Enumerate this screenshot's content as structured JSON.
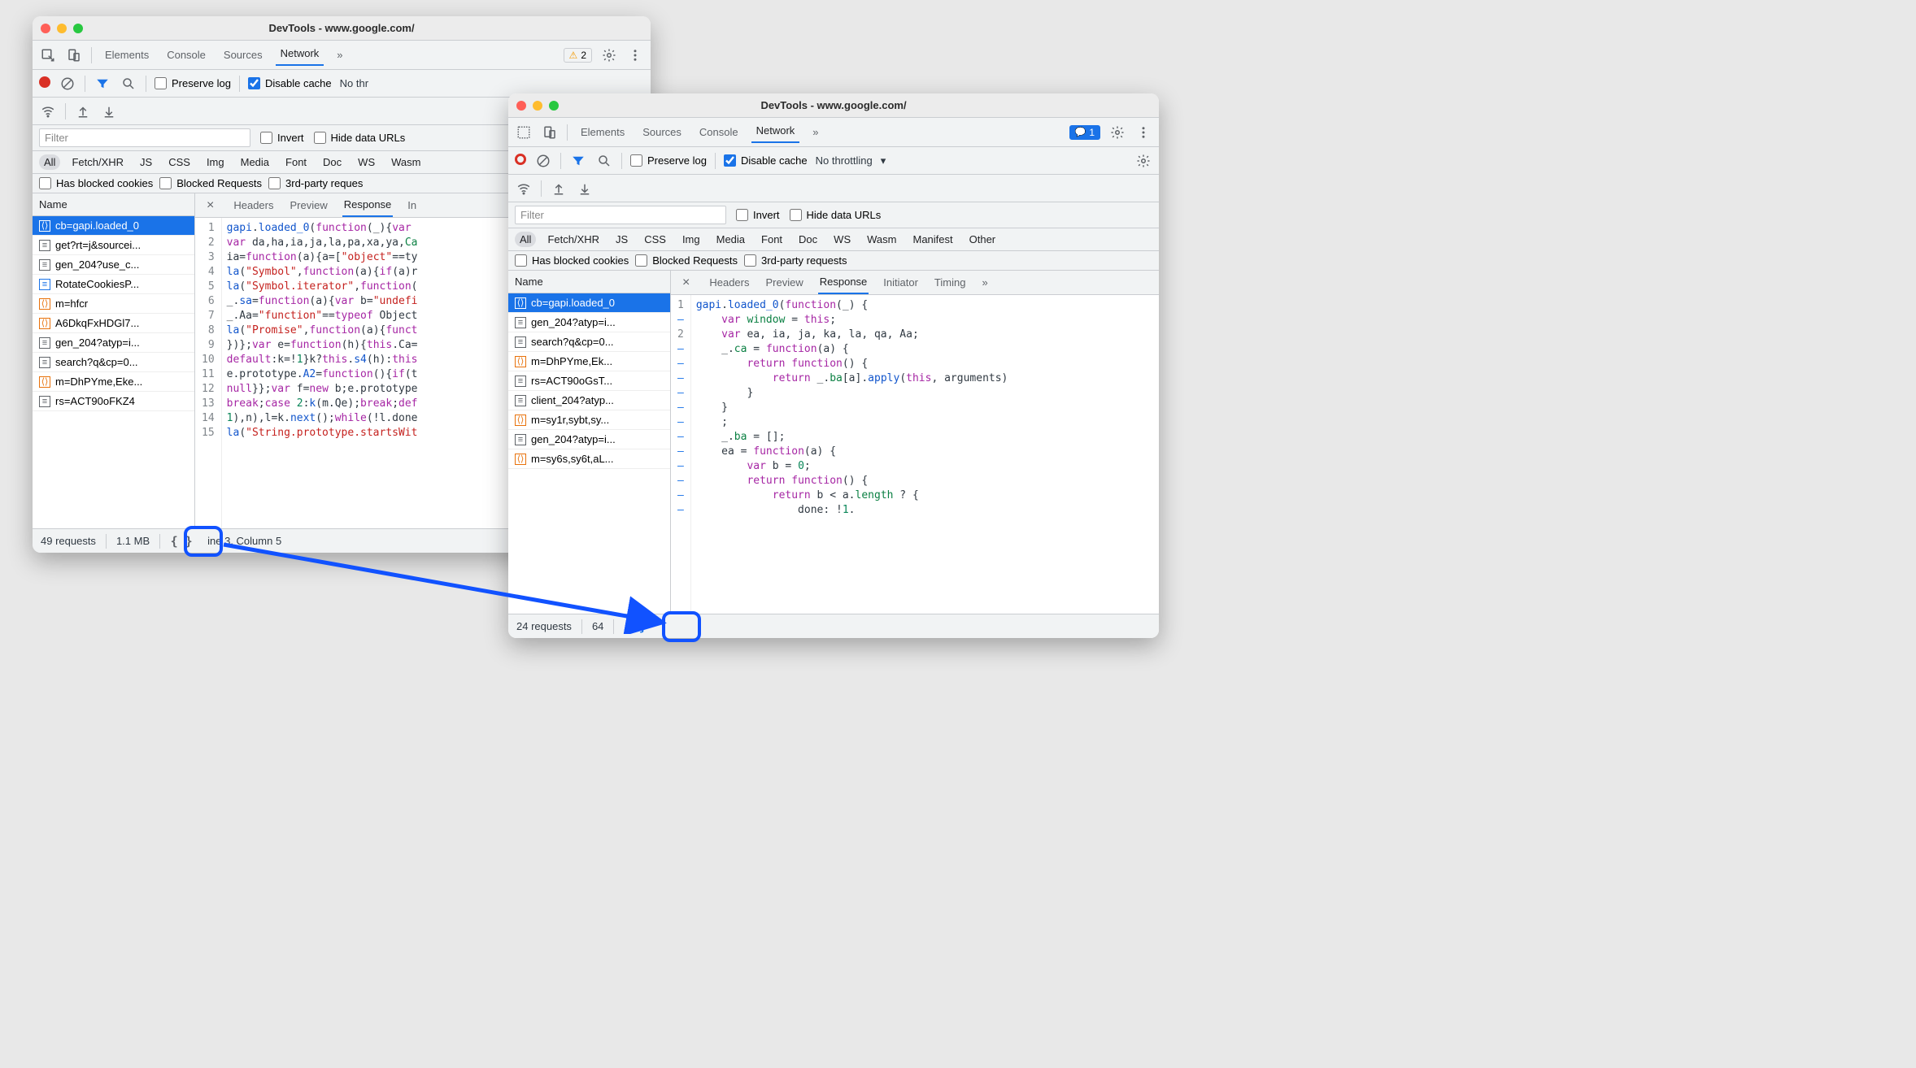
{
  "window1": {
    "title": "DevTools - www.google.com/",
    "topTabs": [
      "Elements",
      "Console",
      "Sources",
      "Network"
    ],
    "topActive": 3,
    "more": "»",
    "warnCount": "2",
    "preserveLabel": "Preserve log",
    "disableCacheLabel": "Disable cache",
    "disableCacheChecked": true,
    "throttling": "No thr",
    "filterPlaceholder": "Filter",
    "invertLabel": "Invert",
    "hideDataLabel": "Hide data URLs",
    "typeChips": [
      "All",
      "Fetch/XHR",
      "JS",
      "CSS",
      "Img",
      "Media",
      "Font",
      "Doc",
      "WS",
      "Wasm"
    ],
    "typeActive": 0,
    "extraChecks": [
      "Has blocked cookies",
      "Blocked Requests",
      "3rd-party reques"
    ],
    "nameHeader": "Name",
    "files": [
      {
        "icon": "orange",
        "name": "cb=gapi.loaded_0",
        "sel": true
      },
      {
        "icon": "doc",
        "name": "get?rt=j&sourcei..."
      },
      {
        "icon": "doc",
        "name": "gen_204?use_c..."
      },
      {
        "icon": "blue",
        "name": "RotateCookiesP..."
      },
      {
        "icon": "orange",
        "name": "m=hfcr"
      },
      {
        "icon": "orange",
        "name": "A6DkqFxHDGl7..."
      },
      {
        "icon": "doc",
        "name": "gen_204?atyp=i..."
      },
      {
        "icon": "doc",
        "name": "search?q&cp=0..."
      },
      {
        "icon": "orange",
        "name": "m=DhPYme,Eke..."
      },
      {
        "icon": "doc",
        "name": "rs=ACT90oFKZ4"
      }
    ],
    "detailTabs": [
      "Headers",
      "Preview",
      "Response",
      "In"
    ],
    "detailActive": 2,
    "codeLines": [
      [
        [
          "fn",
          "gapi"
        ],
        [
          "plain",
          "."
        ],
        [
          "fn",
          "loaded_0"
        ],
        [
          "plain",
          "("
        ],
        [
          "kw",
          "function"
        ],
        [
          "plain",
          "(_){"
        ],
        [
          "kw",
          "var"
        ]
      ],
      [
        [
          "kw",
          "var"
        ],
        [
          "plain",
          " da,ha,ia,ja,la,pa,xa,ya,"
        ],
        [
          "id",
          "Ca"
        ]
      ],
      [
        [
          "plain",
          "ia="
        ],
        [
          "kw",
          "function"
        ],
        [
          "plain",
          "(a){a=["
        ],
        [
          "str",
          "\"object\""
        ],
        [
          "plain",
          "==ty"
        ]
      ],
      [
        [
          "fn",
          "la"
        ],
        [
          "plain",
          "("
        ],
        [
          "str",
          "\"Symbol\""
        ],
        [
          "plain",
          ","
        ],
        [
          "kw",
          "function"
        ],
        [
          "plain",
          "(a){"
        ],
        [
          "kw",
          "if"
        ],
        [
          "plain",
          "(a)r"
        ]
      ],
      [
        [
          "fn",
          "la"
        ],
        [
          "plain",
          "("
        ],
        [
          "str",
          "\"Symbol.iterator\""
        ],
        [
          "plain",
          ","
        ],
        [
          "kw",
          "function"
        ],
        [
          "plain",
          "("
        ]
      ],
      [
        [
          "plain",
          "_."
        ],
        [
          "fn",
          "sa"
        ],
        [
          "plain",
          "="
        ],
        [
          "kw",
          "function"
        ],
        [
          "plain",
          "(a){"
        ],
        [
          "kw",
          "var"
        ],
        [
          "plain",
          " b="
        ],
        [
          "str",
          "\"undefi"
        ]
      ],
      [
        [
          "plain",
          "_.Aa="
        ],
        [
          "str",
          "\"function\""
        ],
        [
          "plain",
          "=="
        ],
        [
          "kw",
          "typeof"
        ],
        [
          "plain",
          " Object"
        ]
      ],
      [
        [
          "fn",
          "la"
        ],
        [
          "plain",
          "("
        ],
        [
          "str",
          "\"Promise\""
        ],
        [
          "plain",
          ","
        ],
        [
          "kw",
          "function"
        ],
        [
          "plain",
          "(a){"
        ],
        [
          "kw",
          "funct"
        ]
      ],
      [
        [
          "plain",
          "})};"
        ],
        [
          "kw",
          "var"
        ],
        [
          "plain",
          " e="
        ],
        [
          "kw",
          "function"
        ],
        [
          "plain",
          "(h){"
        ],
        [
          "kw",
          "this"
        ],
        [
          "plain",
          ".Ca="
        ]
      ],
      [
        [
          "kw",
          "default"
        ],
        [
          "plain",
          ":k=!"
        ],
        [
          "num",
          "1"
        ],
        [
          "plain",
          "}k?"
        ],
        [
          "kw",
          "this"
        ],
        [
          "plain",
          "."
        ],
        [
          "fn",
          "s4"
        ],
        [
          "plain",
          "(h):"
        ],
        [
          "kw",
          "this"
        ]
      ],
      [
        [
          "plain",
          "e.prototype."
        ],
        [
          "fn",
          "A2"
        ],
        [
          "plain",
          "="
        ],
        [
          "kw",
          "function"
        ],
        [
          "plain",
          "(){"
        ],
        [
          "kw",
          "if"
        ],
        [
          "plain",
          "(t"
        ]
      ],
      [
        [
          "kw",
          "null"
        ],
        [
          "plain",
          "}};"
        ],
        [
          "kw",
          "var"
        ],
        [
          "plain",
          " f="
        ],
        [
          "kw",
          "new"
        ],
        [
          "plain",
          " b;e.prototype"
        ]
      ],
      [
        [
          "kw",
          "break"
        ],
        [
          "plain",
          ";"
        ],
        [
          "kw",
          "case"
        ],
        [
          "plain",
          " "
        ],
        [
          "num",
          "2"
        ],
        [
          "plain",
          ":"
        ],
        [
          "fn",
          "k"
        ],
        [
          "plain",
          "(m.Qe);"
        ],
        [
          "kw",
          "break"
        ],
        [
          "plain",
          ";"
        ],
        [
          "kw",
          "def"
        ]
      ],
      [
        [
          "num",
          "1"
        ],
        [
          "plain",
          "),n),l=k."
        ],
        [
          "fn",
          "next"
        ],
        [
          "plain",
          "();"
        ],
        [
          "kw",
          "while"
        ],
        [
          "plain",
          "(!l.done"
        ]
      ],
      [
        [
          "fn",
          "la"
        ],
        [
          "plain",
          "("
        ],
        [
          "str",
          "\"String.prototype.startsWit"
        ]
      ]
    ],
    "status": {
      "requests": "49 requests",
      "size": "1.1 MB",
      "cursor": "ine 3, Column 5"
    }
  },
  "window2": {
    "title": "DevTools - www.google.com/",
    "topTabs": [
      "Elements",
      "Sources",
      "Console",
      "Network"
    ],
    "topActive": 3,
    "more": "»",
    "blueCount": "1",
    "preserveLabel": "Preserve log",
    "disableCacheLabel": "Disable cache",
    "disableCacheChecked": true,
    "throttling": "No throttling",
    "filterPlaceholder": "Filter",
    "invertLabel": "Invert",
    "hideDataLabel": "Hide data URLs",
    "typeChips": [
      "All",
      "Fetch/XHR",
      "JS",
      "CSS",
      "Img",
      "Media",
      "Font",
      "Doc",
      "WS",
      "Wasm",
      "Manifest",
      "Other"
    ],
    "typeActive": 0,
    "extraChecks": [
      "Has blocked cookies",
      "Blocked Requests",
      "3rd-party requests"
    ],
    "nameHeader": "Name",
    "files": [
      {
        "icon": "orange",
        "name": "cb=gapi.loaded_0",
        "sel": true
      },
      {
        "icon": "doc",
        "name": "gen_204?atyp=i..."
      },
      {
        "icon": "doc",
        "name": "search?q&cp=0..."
      },
      {
        "icon": "orange",
        "name": "m=DhPYme,Ek..."
      },
      {
        "icon": "doc",
        "name": "rs=ACT90oGsT..."
      },
      {
        "icon": "doc",
        "name": "client_204?atyp..."
      },
      {
        "icon": "orange",
        "name": "m=sy1r,sybt,sy..."
      },
      {
        "icon": "doc",
        "name": "gen_204?atyp=i..."
      },
      {
        "icon": "orange",
        "name": "m=sy6s,sy6t,aL..."
      }
    ],
    "detailTabs": [
      "Headers",
      "Preview",
      "Response",
      "Initiator",
      "Timing",
      "»"
    ],
    "detailActive": 2,
    "gutter": [
      "1",
      "–",
      "2",
      "–",
      "–",
      "–",
      "–",
      "–",
      "–",
      "–",
      "–",
      "–",
      "–",
      "–",
      "–",
      "–"
    ],
    "codeLines": [
      [
        [
          "fn",
          "gapi"
        ],
        [
          "plain",
          "."
        ],
        [
          "fn",
          "loaded_0"
        ],
        [
          "plain",
          "("
        ],
        [
          "kw",
          "function"
        ],
        [
          "plain",
          "(_) {"
        ]
      ],
      [
        [
          "plain",
          "    "
        ],
        [
          "kw",
          "var"
        ],
        [
          "plain",
          " "
        ],
        [
          "id",
          "window"
        ],
        [
          "plain",
          " = "
        ],
        [
          "kw",
          "this"
        ],
        [
          "plain",
          ";"
        ]
      ],
      [
        [
          "plain",
          "    "
        ],
        [
          "kw",
          "var"
        ],
        [
          "plain",
          " ea, ia, ja, ka, la, qa, Aa;"
        ]
      ],
      [
        [
          "plain",
          "    _."
        ],
        [
          "id",
          "ca"
        ],
        [
          "plain",
          " = "
        ],
        [
          "kw",
          "function"
        ],
        [
          "plain",
          "(a) {"
        ]
      ],
      [
        [
          "plain",
          "        "
        ],
        [
          "kw",
          "return"
        ],
        [
          "plain",
          " "
        ],
        [
          "kw",
          "function"
        ],
        [
          "plain",
          "() {"
        ]
      ],
      [
        [
          "plain",
          "            "
        ],
        [
          "kw",
          "return"
        ],
        [
          "plain",
          " _."
        ],
        [
          "id",
          "ba"
        ],
        [
          "plain",
          "[a]."
        ],
        [
          "fn",
          "apply"
        ],
        [
          "plain",
          "("
        ],
        [
          "kw",
          "this"
        ],
        [
          "plain",
          ", arguments)"
        ]
      ],
      [
        [
          "plain",
          "        }"
        ]
      ],
      [
        [
          "plain",
          "    }"
        ]
      ],
      [
        [
          "plain",
          "    ;"
        ]
      ],
      [
        [
          "plain",
          "    _."
        ],
        [
          "id",
          "ba"
        ],
        [
          "plain",
          " = [];"
        ]
      ],
      [
        [
          "plain",
          "    ea = "
        ],
        [
          "kw",
          "function"
        ],
        [
          "plain",
          "(a) {"
        ]
      ],
      [
        [
          "plain",
          "        "
        ],
        [
          "kw",
          "var"
        ],
        [
          "plain",
          " b = "
        ],
        [
          "num",
          "0"
        ],
        [
          "plain",
          ";"
        ]
      ],
      [
        [
          "plain",
          "        "
        ],
        [
          "kw",
          "return"
        ],
        [
          "plain",
          " "
        ],
        [
          "kw",
          "function"
        ],
        [
          "plain",
          "() {"
        ]
      ],
      [
        [
          "plain",
          "            "
        ],
        [
          "kw",
          "return"
        ],
        [
          "plain",
          " b < a."
        ],
        [
          "id",
          "length"
        ],
        [
          "plain",
          " ? {"
        ]
      ],
      [
        [
          "plain",
          "                done: !"
        ],
        [
          "num",
          "1"
        ],
        [
          "plain",
          "."
        ]
      ]
    ],
    "status": {
      "requests": "24 requests",
      "size": "64"
    }
  }
}
